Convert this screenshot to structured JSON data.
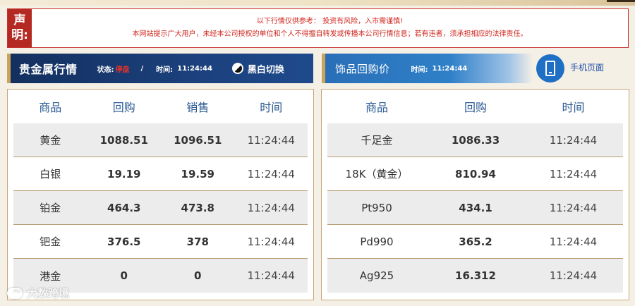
{
  "notice": {
    "tag": [
      "声",
      "明:"
    ],
    "line1": "以下行情仅供参考： 投资有风险，入市需谨慎!",
    "line2": "本网站提示广大用户，未经本公司授权的单位和个人不得擅自转发或传播本公司行情信息；若有违者，须承担相应的法律责任。"
  },
  "left_header": {
    "title": "贵金属行情",
    "status_label": "状态:",
    "status_value": "停盘",
    "separator": "/",
    "time_label": "时间:",
    "time_value": "11:24:44",
    "toggle_label": "黑白切换"
  },
  "right_header": {
    "title": "饰品回购价",
    "time_label": "时间:",
    "time_value": "11:24:44",
    "mobile_label": "手机页面"
  },
  "left_table": {
    "columns": [
      "商品",
      "回购",
      "销售",
      "时间"
    ],
    "rows": [
      {
        "name": "黄金",
        "buy": "1088.51",
        "sell": "1096.51",
        "time": "11:24:44"
      },
      {
        "name": "白银",
        "buy": "19.19",
        "sell": "19.59",
        "time": "11:24:44"
      },
      {
        "name": "铂金",
        "buy": "464.3",
        "sell": "473.8",
        "time": "11:24:44"
      },
      {
        "name": "钯金",
        "buy": "376.5",
        "sell": "378",
        "time": "11:24:44"
      },
      {
        "name": "港金",
        "buy": "0",
        "sell": "0",
        "time": "11:24:44"
      }
    ]
  },
  "right_table": {
    "columns": [
      "商品",
      "回购",
      "时间"
    ],
    "rows": [
      {
        "name": "千足金",
        "buy": "1086.33",
        "time": "11:24:44"
      },
      {
        "name": "18K（黄金）",
        "buy": "810.94",
        "time": "11:24:44"
      },
      {
        "name": "Pt950",
        "buy": "434.1",
        "time": "11:24:44"
      },
      {
        "name": "Pd990",
        "buy": "365.2",
        "time": "11:24:44"
      },
      {
        "name": "Ag925",
        "buy": "16.312",
        "time": "11:24:44"
      }
    ]
  },
  "watermark": {
    "text": "大数跨境"
  },
  "colors": {
    "navy": "#13305f",
    "blue": "#2f80c8",
    "red": "#c8302e",
    "gold": "#c9a45a",
    "header_text": "#2a5a93"
  }
}
